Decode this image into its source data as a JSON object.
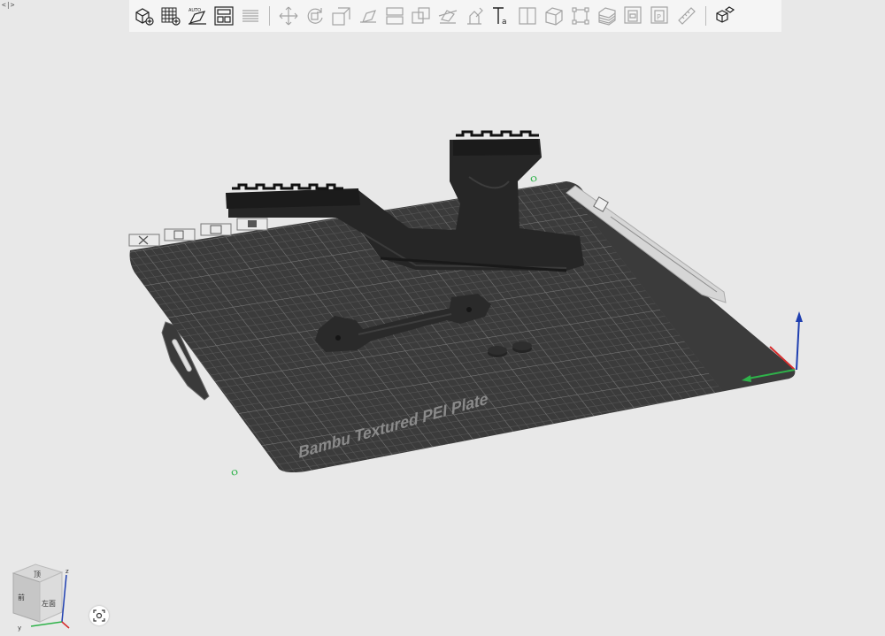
{
  "collapse_handle": "<|>",
  "plate": {
    "label": "Bambu Textured PEI Plate",
    "origin_front_label": "0",
    "origin_back_label": "0"
  },
  "view_cube": {
    "front_label": "左面",
    "top_label": "顶",
    "side_label": "前",
    "axis_z": "z",
    "axis_y": "y"
  },
  "colors": {
    "background": "#e8e8e8",
    "plate": "#3b3b3b",
    "grid": "#5e5e5e",
    "axis_x": "#d62b2b",
    "axis_y": "#2fb24a",
    "axis_z": "#1f3fb0"
  },
  "toolbar_icons": [
    {
      "name": "add-object-icon",
      "enabled": true
    },
    {
      "name": "add-plate-icon",
      "enabled": true
    },
    {
      "name": "auto-orient-icon",
      "enabled": true
    },
    {
      "name": "arrange-icon",
      "enabled": true
    },
    {
      "name": "layers-icon",
      "enabled": false
    },
    {
      "name": "move-icon",
      "enabled": false
    },
    {
      "name": "rotate-icon",
      "enabled": false
    },
    {
      "name": "scale-icon",
      "enabled": false
    },
    {
      "name": "lay-on-face-icon",
      "enabled": false
    },
    {
      "name": "split-icon",
      "enabled": false
    },
    {
      "name": "boolean-icon",
      "enabled": false
    },
    {
      "name": "cut-icon",
      "enabled": false
    },
    {
      "name": "support-paint-icon",
      "enabled": false
    },
    {
      "name": "text-icon",
      "enabled": true
    },
    {
      "name": "seam-paint-icon",
      "enabled": false
    },
    {
      "name": "color-paint-icon",
      "enabled": false
    },
    {
      "name": "measure-box-icon",
      "enabled": false
    },
    {
      "name": "slice-layer-icon",
      "enabled": false
    },
    {
      "name": "variable-layer-icon",
      "enabled": false
    },
    {
      "name": "object-info-icon",
      "enabled": false
    },
    {
      "name": "plate-info-icon",
      "enabled": false
    },
    {
      "name": "ruler-icon",
      "enabled": false
    },
    {
      "name": "assembly-icon",
      "enabled": true
    }
  ]
}
